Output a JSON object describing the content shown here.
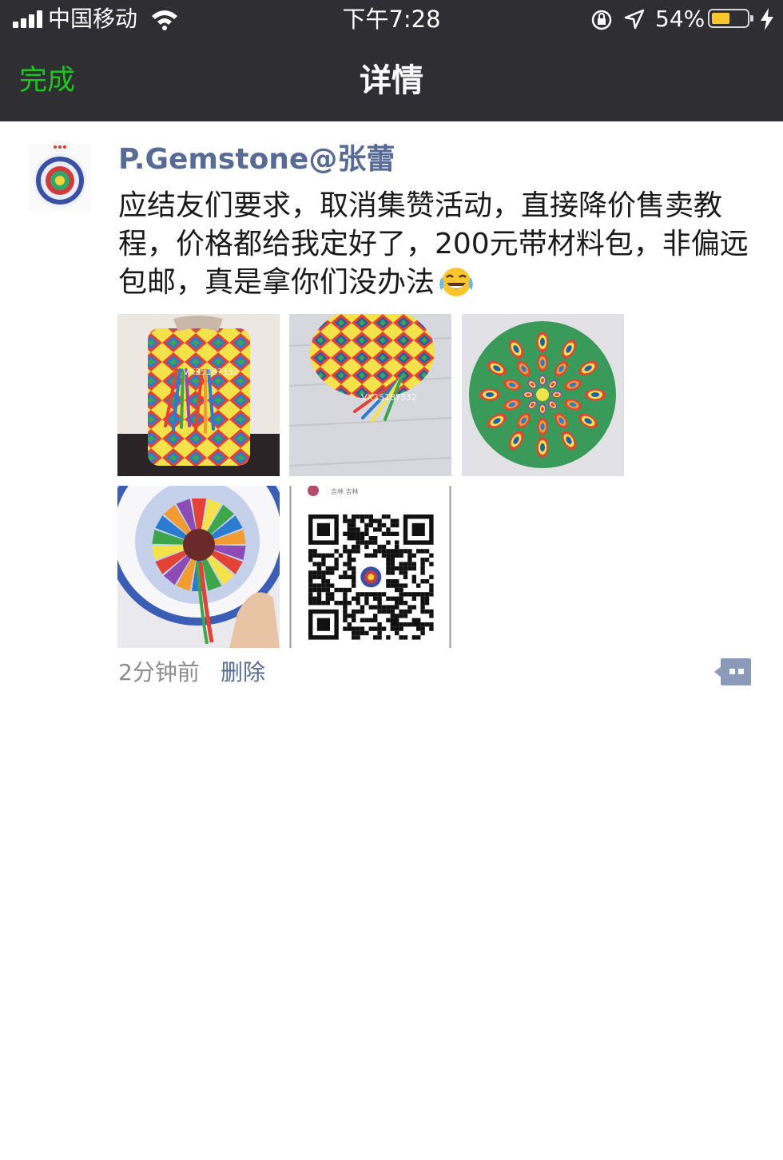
{
  "status_bar": {
    "carrier": "中国移动",
    "time": "下午7:28",
    "battery_percent_text": "54%",
    "battery_level": 0.54,
    "icons": [
      "signal-icon",
      "wifi-icon",
      "rotation-lock-icon",
      "location-icon",
      "battery-icon",
      "charging-icon"
    ]
  },
  "nav": {
    "done_label": "完成",
    "title": "详情"
  },
  "post": {
    "author": "P.Gemstone@张蕾",
    "text": "应结友们要求，取消集赞活动，直接降价售卖教程，价格都给我定好了，200元带材料包，非偏远包邮，真是拿你们没办法",
    "emoji": "face-with-tears-of-joy",
    "photos": [
      {
        "subject": "bucket bag with tassels",
        "watermark": "VX2518?332"
      },
      {
        "subject": "bucket bag lying",
        "watermark": "VX2518?332"
      },
      {
        "subject": "mandala pattern"
      },
      {
        "subject": "bag top held in hand"
      },
      {
        "subject": "qr code",
        "caption": "吉林 吉林"
      }
    ],
    "time_ago": "2分钟前",
    "delete_label": "删除"
  },
  "colors": {
    "nav_bg": "#2e2e33",
    "done_green": "#1fc31f",
    "link_blue": "#576b95",
    "time_gray": "#8c8c8c"
  }
}
